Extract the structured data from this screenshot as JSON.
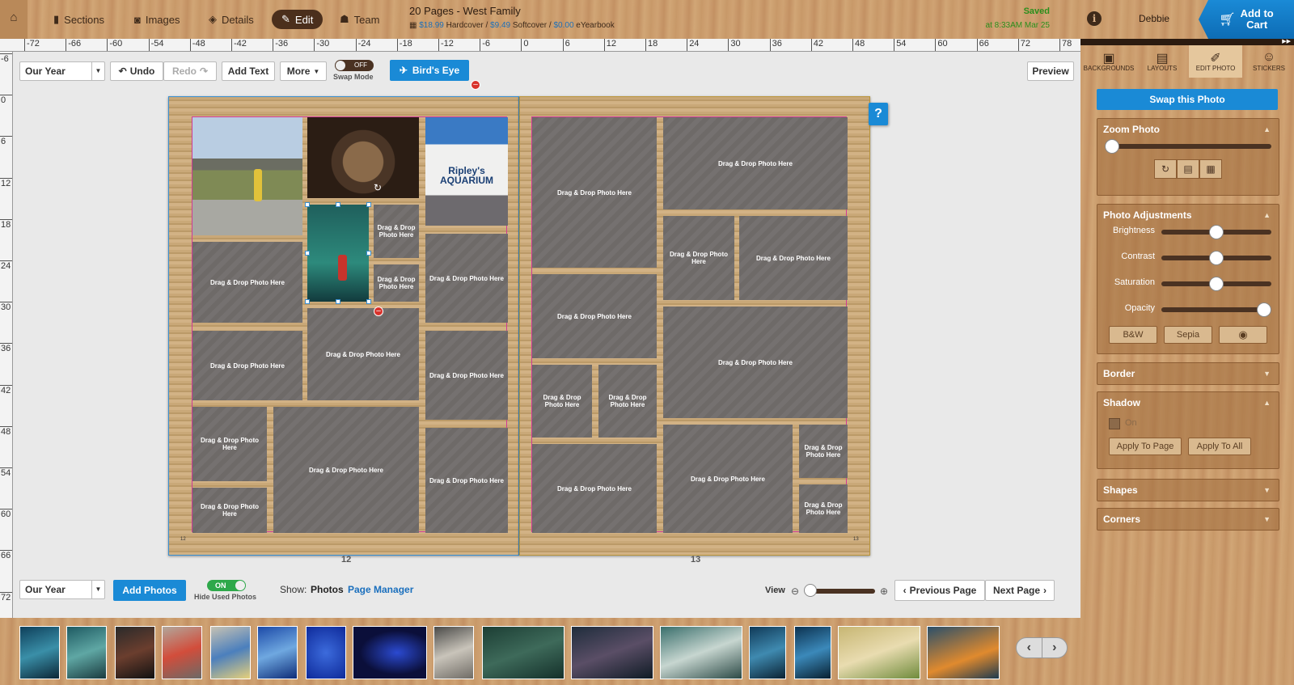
{
  "topbar": {
    "nav": [
      {
        "label": "Sections",
        "icon": "bookmark-icon"
      },
      {
        "label": "Images",
        "icon": "camera-icon"
      },
      {
        "label": "Details",
        "icon": "tag-icon"
      },
      {
        "label": "Edit",
        "icon": "pencil-icon"
      },
      {
        "label": "Team",
        "icon": "people-icon"
      }
    ],
    "project_title": "20 Pages - West Family",
    "prices": {
      "hardcover": "$18.99",
      "hardcover_label": "Hardcover /",
      "softcover": "$9.49",
      "softcover_label": "Softcover /",
      "ebook": "$0.00",
      "ebook_label": "eYearbook"
    },
    "saved": "Saved",
    "saved_time": "at 8:33AM Mar 25",
    "user": "Debbie",
    "cart_line1": "Add to",
    "cart_line2": "Cart"
  },
  "ruler": {
    "h_ticks": [
      "-72",
      "-66",
      "-60",
      "-54",
      "-48",
      "-42",
      "-36",
      "-30",
      "-24",
      "-18",
      "-12",
      "-6",
      "0",
      "6",
      "12",
      "18",
      "24",
      "30",
      "36",
      "42",
      "48",
      "54",
      "60",
      "66",
      "72",
      "78"
    ],
    "v_ticks": [
      "-6",
      "0",
      "6",
      "12",
      "18",
      "24",
      "30",
      "36",
      "42",
      "48",
      "54",
      "60",
      "66",
      "72"
    ]
  },
  "toolbar": {
    "year_select": "Our Year",
    "undo": "Undo",
    "redo": "Redo",
    "add_text": "Add Text",
    "more": "More",
    "swap_toggle": "OFF",
    "swap_label": "Swap Mode",
    "birds_eye": "Bird's Eye",
    "preview": "Preview"
  },
  "placeholder_text": "Drag & Drop Photo Here",
  "pages": {
    "left_number": "12",
    "right_number": "13",
    "left_corner": "12",
    "right_corner": "13"
  },
  "help": "?",
  "bottom": {
    "year_select": "Our Year",
    "add_photos": "Add Photos",
    "hide_toggle": "ON",
    "hide_label": "Hide Used Photos",
    "show_label": "Show:",
    "show_photos": "Photos",
    "page_manager": "Page Manager",
    "view": "View",
    "prev_page": "Previous Page",
    "next_page": "Next Page"
  },
  "right_panel": {
    "tabs": [
      {
        "label": "BACKGROUNDS",
        "icon": "image-icon"
      },
      {
        "label": "LAYOUTS",
        "icon": "layout-icon"
      },
      {
        "label": "EDIT PHOTO",
        "icon": "brush-icon"
      },
      {
        "label": "STICKERS",
        "icon": "smiley-icon"
      }
    ],
    "swap_photo": "Swap this Photo",
    "zoom_photo": "Zoom Photo",
    "zoom_level": 0,
    "photo_adjustments": "Photo Adjustments",
    "adjustments": [
      {
        "label": "Brightness",
        "level": 0.5
      },
      {
        "label": "Contrast",
        "level": 0.5
      },
      {
        "label": "Saturation",
        "level": 0.5
      },
      {
        "label": "Opacity",
        "level": 1.0
      }
    ],
    "bw": "B&W",
    "sepia": "Sepia",
    "border": "Border",
    "shadow": "Shadow",
    "shadow_on": "On",
    "apply_page": "Apply To Page",
    "apply_all": "Apply To All",
    "shapes": "Shapes",
    "corners": "Corners"
  },
  "colors": {
    "accent": "#1a8ad6",
    "wood": "#c9986a",
    "saved": "#2a8f1c",
    "placeholder_border": "#d03a96"
  }
}
